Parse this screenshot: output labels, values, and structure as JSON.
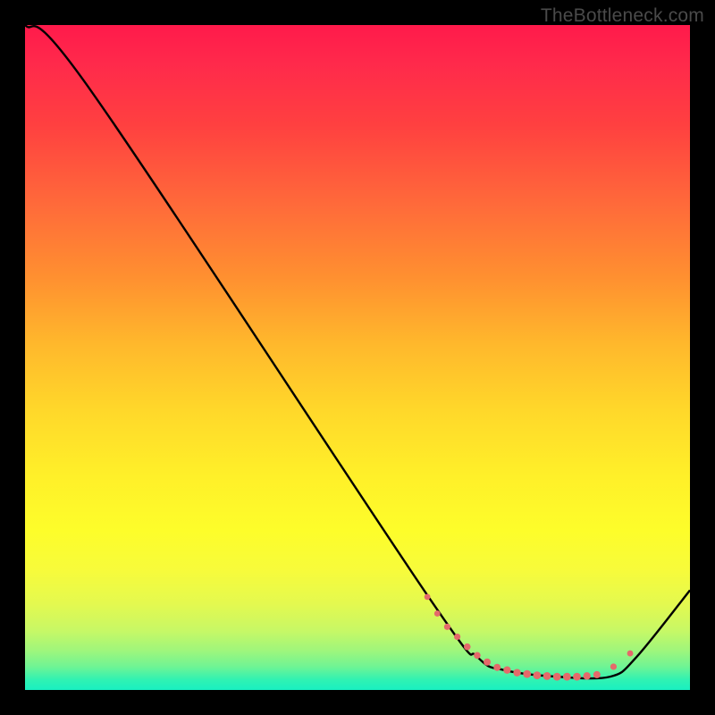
{
  "watermark": "TheBottleneck.com",
  "chart_data": {
    "type": "line",
    "title": "",
    "xlabel": "",
    "ylabel": "",
    "xlim": [
      0,
      100
    ],
    "ylim": [
      0,
      100
    ],
    "series": [
      {
        "name": "curve",
        "x": [
          0,
          10,
          60,
          68,
          72,
          80,
          88,
          92,
          100
        ],
        "y": [
          100,
          90,
          15,
          5,
          3,
          2,
          2,
          5,
          15
        ]
      }
    ],
    "markers": {
      "name": "dotted-segment",
      "x": [
        60.5,
        62,
        63.5,
        65,
        66.5,
        68,
        69.5,
        71,
        72.5,
        74,
        75.5,
        77,
        78.5,
        80,
        81.5,
        83,
        84.5,
        86,
        88.5,
        91
      ],
      "y": [
        14,
        11.5,
        9.5,
        8,
        6.5,
        5.2,
        4.2,
        3.4,
        3,
        2.6,
        2.4,
        2.2,
        2.1,
        2.0,
        2.0,
        2.0,
        2.1,
        2.3,
        3.5,
        5.5
      ],
      "sizes": [
        3.4,
        3.4,
        3.6,
        3.6,
        3.8,
        3.8,
        4.0,
        4.0,
        4.2,
        4.2,
        4.4,
        4.4,
        4.4,
        4.4,
        4.4,
        4.4,
        4.2,
        4.0,
        3.6,
        3.4
      ]
    },
    "legend": null,
    "grid": false
  },
  "colors": {
    "curve_stroke": "#000000",
    "marker_fill": "#e46a6a",
    "background_top": "#ff1a4b",
    "background_bottom": "#19efc1",
    "frame": "#000000"
  }
}
